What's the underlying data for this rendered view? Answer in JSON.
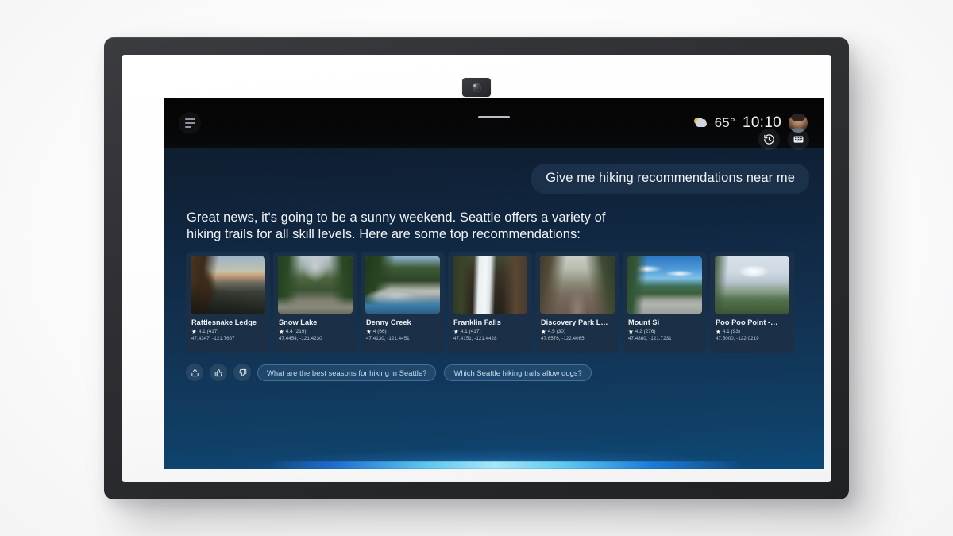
{
  "device": {
    "name": "smart-display"
  },
  "statusbar": {
    "menu_icon": "hamburger-menu-icon",
    "weather_icon": "sun-behind-cloud-icon",
    "temperature": "65°",
    "time": "10:10",
    "avatar": "user-avatar"
  },
  "actions": [
    {
      "name": "history-button",
      "icon": "clock-history-icon"
    },
    {
      "name": "keyboard-button",
      "icon": "keyboard-icon"
    }
  ],
  "conversation": {
    "user_prompt": "Give me hiking recommendations near me",
    "assistant_response": "Great news, it's going to be a sunny weekend. Seattle offers a variety of hiking trails for all skill levels. Here are some top recommendations:"
  },
  "cards": [
    {
      "name": "Rattlesnake Ledge",
      "rating": "4.1",
      "reviews": "(417)",
      "coords": "47.4347, -121.7687",
      "image": "cliff-ridge-sunset-photo"
    },
    {
      "name": "Snow Lake",
      "rating": "4.4",
      "reviews": "(219)",
      "coords": "47.4454, -121.4230",
      "image": "forest-river-valley-photo"
    },
    {
      "name": "Denny Creek",
      "rating": "4",
      "reviews": "(66)",
      "coords": "47.4130, -121.4451",
      "image": "rocky-creek-forest-photo"
    },
    {
      "name": "Franklin Falls",
      "rating": "4.1",
      "reviews": "(417)",
      "coords": "47.4151, -121.4428",
      "image": "waterfall-photo"
    },
    {
      "name": "Discovery Park L…",
      "rating": "4.5",
      "reviews": "(30)",
      "coords": "47.6576, -122.4065",
      "image": "wooded-trail-photo"
    },
    {
      "name": "Mount Si",
      "rating": "4.2",
      "reviews": "(276)",
      "coords": "47.4880, -121.7231",
      "image": "summit-view-clouds-photo"
    },
    {
      "name": "Poo Poo Point -…",
      "rating": "4.1",
      "reviews": "(93)",
      "coords": "47.5000, -122.0219",
      "image": "snowy-mountain-vista-photo"
    }
  ],
  "feedback": [
    {
      "name": "share-button",
      "icon": "share-icon"
    },
    {
      "name": "thumbs-up-button",
      "icon": "thumbs-up-icon"
    },
    {
      "name": "thumbs-down-button",
      "icon": "thumbs-down-icon"
    }
  ],
  "suggestions": [
    "What are the best seasons for hiking in Seattle?",
    "Which Seattle hiking trails allow dogs?"
  ],
  "colors": {
    "accent": "#5ec8ef",
    "card_bg": "#1b3046",
    "bubble_bg": "#1b3149",
    "chip_text": "#c9dcee"
  }
}
